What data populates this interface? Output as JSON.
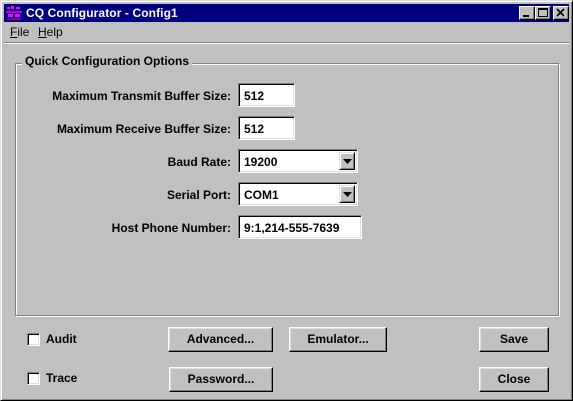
{
  "window": {
    "title": "CQ Configurator - Config1",
    "titlebar_color": "#000080",
    "face_color": "#c0c0c0"
  },
  "menu": {
    "file_underline": "F",
    "file_rest": "ile",
    "help_underline": "H",
    "help_rest": "elp"
  },
  "quick_config": {
    "group_title": "Quick Configuration Options",
    "max_transmit_label": "Maximum Transmit Buffer Size:",
    "max_transmit_value": "512",
    "max_receive_label": "Maximum Receive Buffer Size:",
    "max_receive_value": "512",
    "baud_rate_label": "Baud Rate:",
    "baud_rate_value": "19200",
    "serial_port_label": "Serial Port:",
    "serial_port_value": "COM1",
    "host_phone_label": "Host Phone Number:",
    "host_phone_value": "9:1,214-555-7639"
  },
  "options": {
    "audit_label": "Audit",
    "audit_checked": false,
    "trace_label": "Trace",
    "trace_checked": false
  },
  "buttons": {
    "advanced": "Advanced...",
    "emulator": "Emulator...",
    "save": "Save",
    "password": "Password...",
    "close": "Close"
  },
  "icons": {
    "app": "cq-app-icon",
    "minimize": "minimize-icon",
    "maximize": "maximize-icon",
    "close": "close-icon",
    "dropdown": "chevron-down-icon"
  }
}
